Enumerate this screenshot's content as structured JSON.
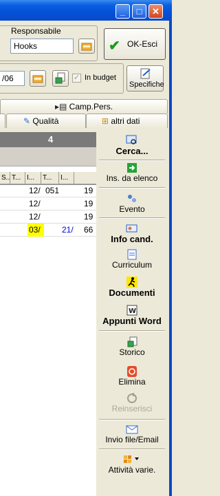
{
  "window": {
    "controls": {
      "minimize": "_",
      "maximize": "□",
      "close": "✕"
    }
  },
  "top": {
    "responsabile_label": "Responsabile",
    "responsabile_value": "Hooks",
    "ok_label": "OK-Esci",
    "date_fragment": "/06",
    "in_budget_label": "In budget",
    "specifiche_label": "Specifiche"
  },
  "tabs": {
    "row1": {
      "camp_pers": "Camp.Pers."
    },
    "row2": {
      "qualita": "Qualità",
      "altri_dati": "altri dati"
    }
  },
  "grid": {
    "top_number": "4",
    "headers": [
      "S...",
      "T...",
      "I...",
      "T...",
      "I..."
    ],
    "rows": [
      {
        "c1": "12/",
        "c2": "051",
        "c3": "",
        "c4": "19",
        "highlight": false
      },
      {
        "c1": "12/",
        "c2": "",
        "c3": "",
        "c4": "19",
        "highlight": false
      },
      {
        "c1": "12/",
        "c2": "",
        "c3": "",
        "c4": "19",
        "highlight": false
      },
      {
        "c1": "03/",
        "c2": "",
        "c3": "21/",
        "c4": "66",
        "highlight": true
      }
    ]
  },
  "side": {
    "cerca": "Cerca...",
    "ins_elenco": "Ins. da elenco",
    "evento": "Evento",
    "info_cand": "Info cand.",
    "curriculum": "Curriculum",
    "documenti": "Documenti",
    "appunti_word": "Appunti Word",
    "storico": "Storico",
    "elimina": "Elimina",
    "reinserisci": "Reinserisci",
    "invio_file": "Invio file/Email",
    "attivita_varie": "Attività varie."
  },
  "colors": {
    "titlebar": "#0550d8",
    "highlight": "#ffff00",
    "blue_text": "#0000cc",
    "ok_check": "#1a9c1a"
  }
}
